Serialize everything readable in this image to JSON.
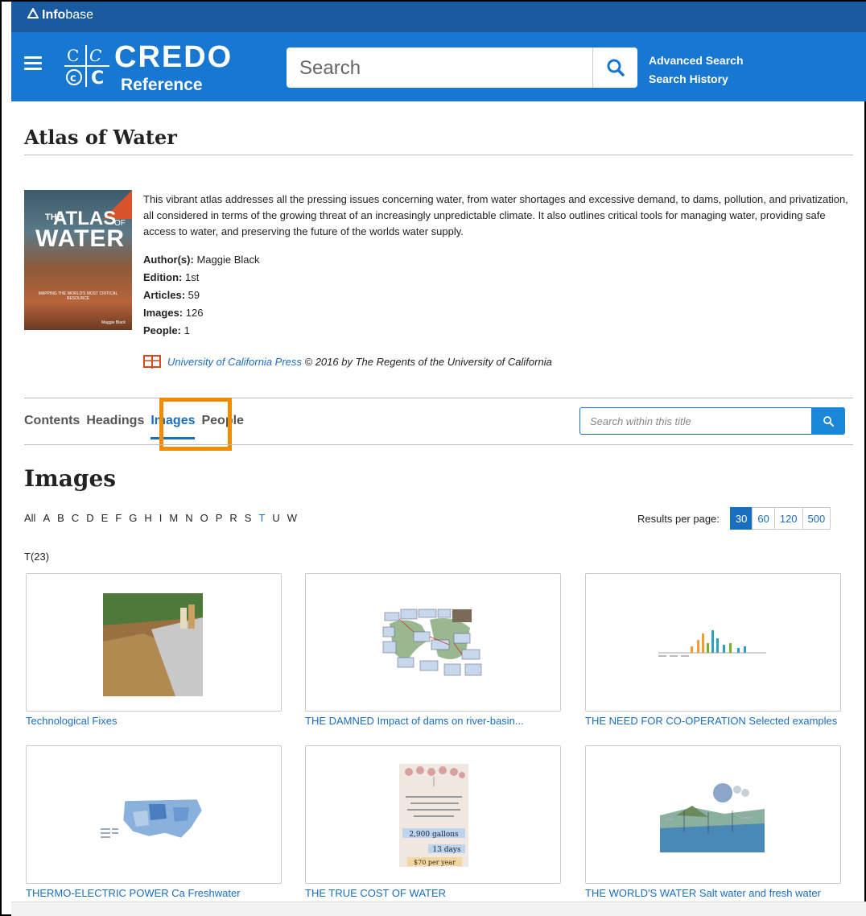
{
  "topbar": {
    "brand_bold": "Info",
    "brand_thin": "base"
  },
  "header": {
    "logo_text": "CREDO",
    "logo_sub": "Reference",
    "search_placeholder": "Search",
    "links": [
      "Advanced Search",
      "Search History"
    ]
  },
  "book": {
    "title": "Atlas of Water",
    "description": "This vibrant atlas addresses all the pressing issues concerning water, from water shortages and excessive demand, to dams, pollution, and privatization, all considered in terms of the growing threat of an increasingly unpredictable climate. It also outlines critical tools for managing water, providing safe access to water, and preserving the future of the worlds water supply.",
    "meta": [
      {
        "label": "Author(s):",
        "value": "Maggie Black"
      },
      {
        "label": "Edition:",
        "value": "1st"
      },
      {
        "label": "Articles:",
        "value": "59"
      },
      {
        "label": "Images:",
        "value": "126"
      },
      {
        "label": "People:",
        "value": "1"
      }
    ],
    "publisher": "University of California Press",
    "copyright": "© 2016 by The Regents of the University of California",
    "cover": {
      "the": "THE",
      "atlas": "ATLAS",
      "of": "OF",
      "water": "WATER",
      "subtitle": "MAPPING THE WORLD'S MOST CRITICAL RESOURCE",
      "author": "Maggie Black"
    }
  },
  "tabs": [
    {
      "label": "Contents",
      "active": false
    },
    {
      "label": "Headings",
      "active": false
    },
    {
      "label": "Images",
      "active": true
    },
    {
      "label": "People",
      "active": false
    }
  ],
  "within_placeholder": "Search within this title",
  "images_heading": "Images",
  "alphabet": [
    "All",
    "A",
    "B",
    "C",
    "D",
    "E",
    "F",
    "G",
    "H",
    "I",
    "M",
    "N",
    "O",
    "P",
    "R",
    "S",
    "T",
    "U",
    "W"
  ],
  "alphabet_selected": "T",
  "results_per_page": {
    "label": "Results per page:",
    "options": [
      "30",
      "60",
      "120",
      "500"
    ],
    "selected": "30"
  },
  "count_label": "T(23)",
  "images": [
    {
      "caption": "Technological Fixes"
    },
    {
      "caption": "THE DAMNED Impact of dams on river-basin..."
    },
    {
      "caption": "THE NEED FOR CO-OPERATION Selected examples"
    },
    {
      "caption": "THERMO-ELECTRIC POWER Ca Freshwater withdrawals..."
    },
    {
      "caption": "THE TRUE COST OF WATER"
    },
    {
      "caption": "THE WORLD'S WATER Salt water and fresh water by..."
    }
  ],
  "thumb_text": {
    "gallons": "2,900 gallons",
    "days": "13 days",
    "per_year": "$70 per year"
  }
}
